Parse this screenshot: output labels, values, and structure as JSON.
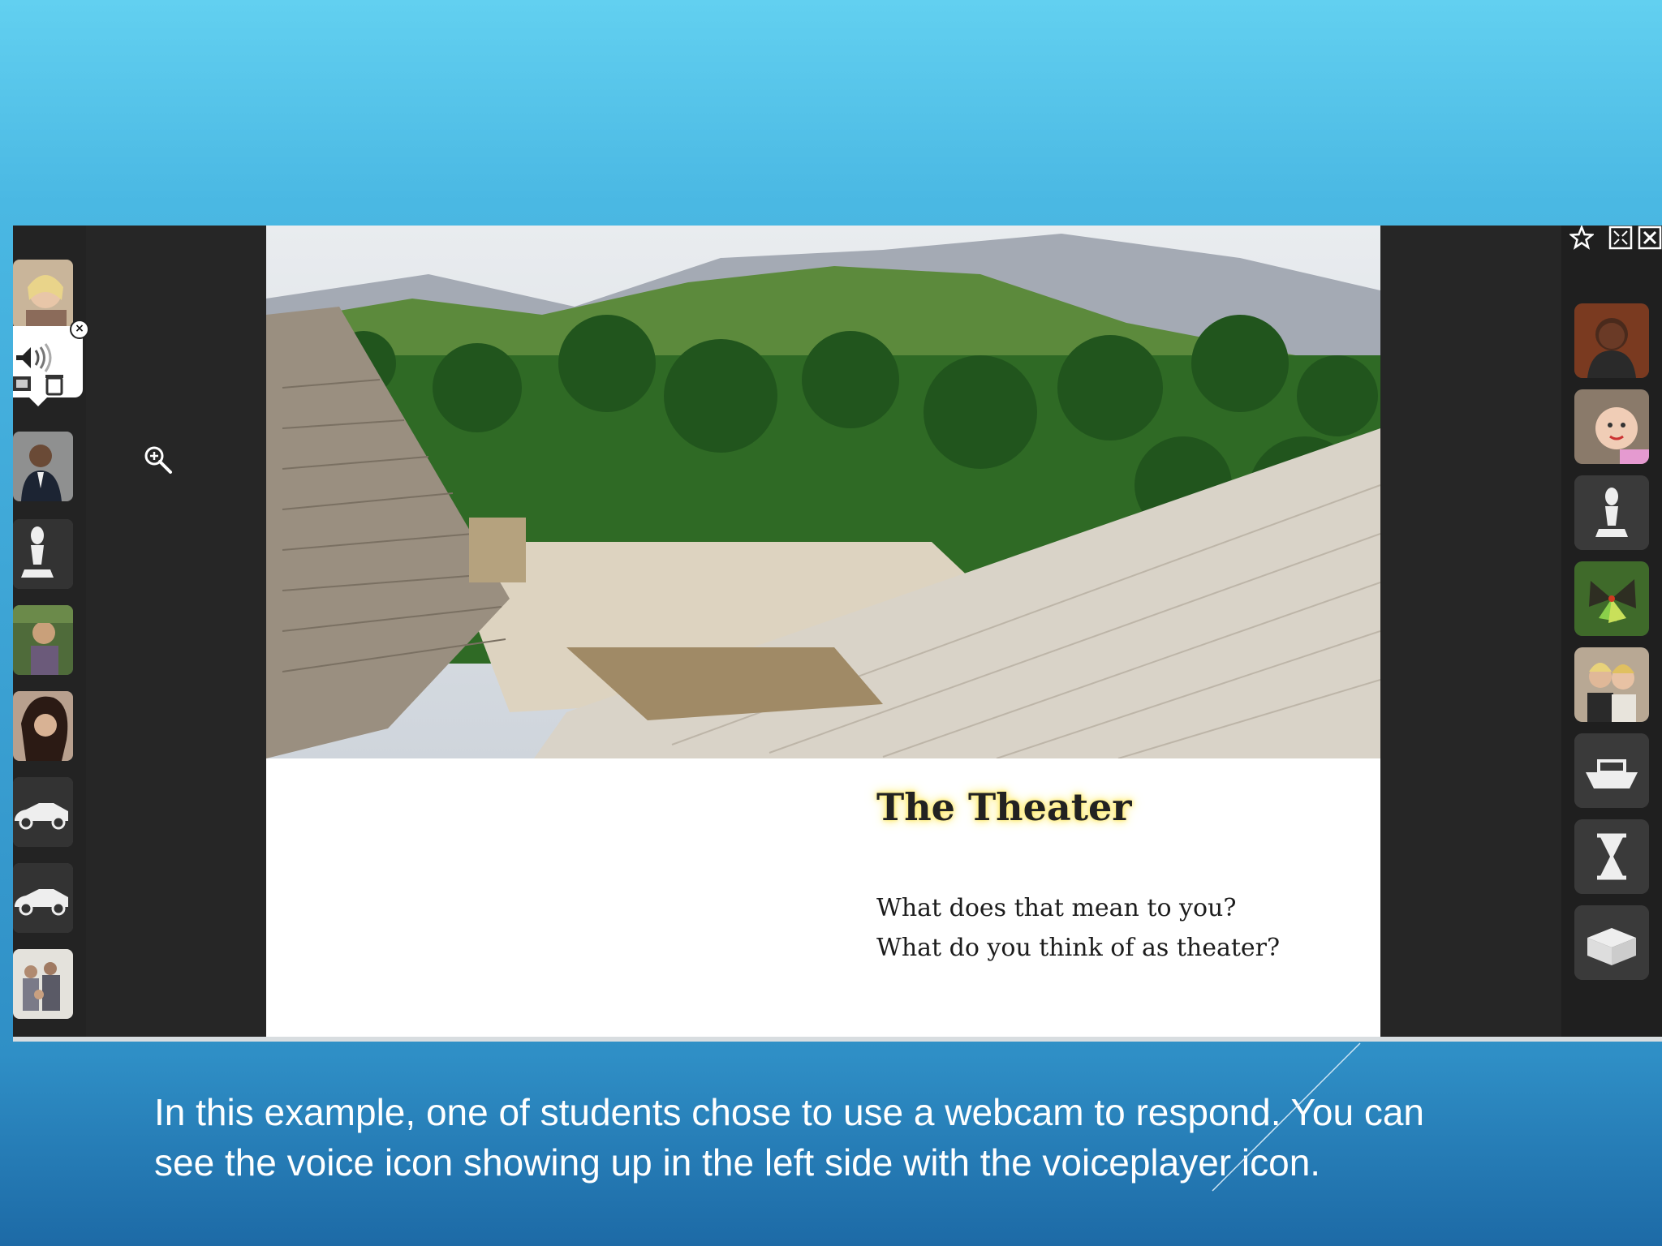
{
  "slide": {
    "title": "The Theater",
    "question_1": "What does that mean to you?",
    "question_2": "What do you think of as theater?"
  },
  "caption": {
    "line_1": "In this example, one of students chose to use a webcam to respond. You can",
    "line_2": "see the voice icon showing up in the left side with the voiceplayer icon."
  },
  "left_panel": {
    "avatars": [
      "avatar-woman-blonde",
      "avatar-man-suit",
      "chess-bishop-icon",
      "avatar-woman-green",
      "avatar-woman-dark-hair",
      "car-icon",
      "car-icon",
      "avatar-family"
    ],
    "voice_popup_icons": [
      "speaker-icon",
      "recording-icon",
      "trash-icon"
    ]
  },
  "right_panel": {
    "top_controls": [
      "star-icon",
      "fullscreen-icon",
      "close-icon"
    ],
    "tiles": [
      "avatar-woman-smiling",
      "avatar-baby",
      "chess-bishop-icon",
      "butterfly-image",
      "avatar-two-girls",
      "boat-icon",
      "hourglass-icon",
      "box-icon"
    ]
  },
  "colors": {
    "background_top": "#62d0f0",
    "background_bottom": "#1d6aa6",
    "panel_dark": "#262626",
    "title_highlight": "#ffec6a"
  }
}
